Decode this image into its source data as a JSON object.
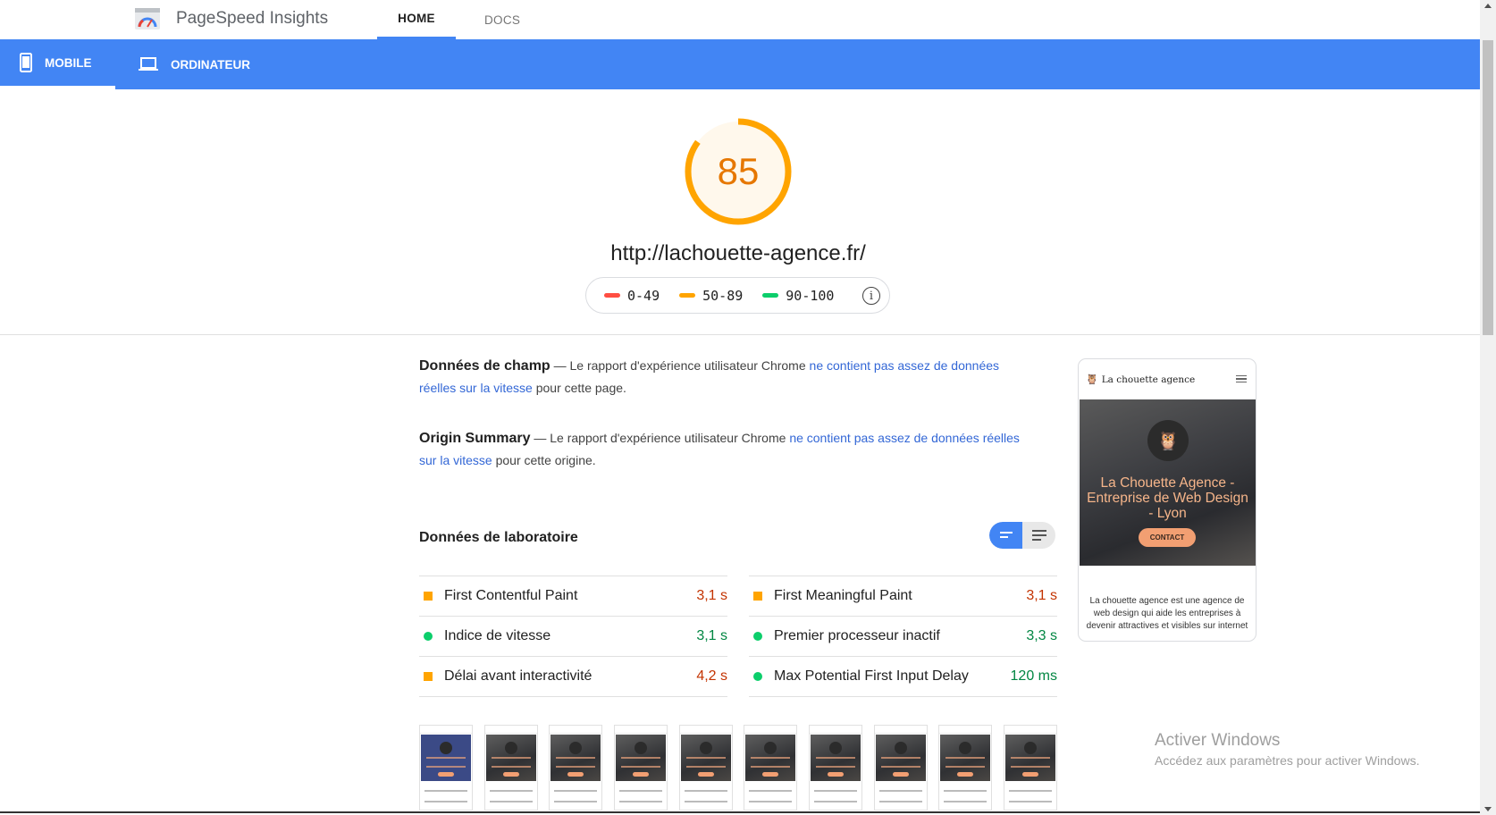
{
  "header": {
    "brand": "PageSpeed Insights",
    "nav": [
      "HOME",
      "DOCS"
    ]
  },
  "device_tabs": {
    "mobile": "MOBILE",
    "desktop": "ORDINATEUR"
  },
  "score": {
    "value": "85",
    "fraction": 0.85,
    "color": "#ffa400"
  },
  "url": "http://lachouette-agence.fr/",
  "legend": {
    "poor": "0-49",
    "average": "50-89",
    "good": "90-100",
    "colors": {
      "poor": "#ff4e42",
      "average": "#ffa400",
      "good": "#0cce6b"
    }
  },
  "field_data": {
    "title": "Données de champ",
    "prefix": " — Le rapport d'expérience utilisateur Chrome ",
    "link": "ne contient pas assez de données réelles sur la vitesse",
    "suffix": " pour cette page."
  },
  "origin_summary": {
    "title": "Origin Summary",
    "prefix": " — Le rapport d'expérience utilisateur Chrome ",
    "link": "ne contient pas assez de données réelles sur la vitesse",
    "suffix": " pour cette origine."
  },
  "lab": {
    "title": "Données de laboratoire",
    "metrics": [
      {
        "label": "First Contentful Paint",
        "value": "3,1 s",
        "status": "average"
      },
      {
        "label": "First Meaningful Paint",
        "value": "3,1 s",
        "status": "average"
      },
      {
        "label": "Indice de vitesse",
        "value": "3,1 s",
        "status": "pass"
      },
      {
        "label": "Premier processeur inactif",
        "value": "3,3 s",
        "status": "pass"
      },
      {
        "label": "Délai avant interactivité",
        "value": "4,2 s",
        "status": "average"
      },
      {
        "label": "Max Potential First Input Delay",
        "value": "120 ms",
        "status": "pass"
      }
    ]
  },
  "preview": {
    "site_name": "La chouette agence",
    "hero_text": "La Chouette Agence - Entreprise de Web Design - Lyon",
    "cta": "CONTACT",
    "body": "La chouette agence est une agence de web design qui aide les entreprises à devenir attractives et visibles sur internet"
  },
  "filmstrip_count": 10,
  "watermark": {
    "title": "Activer Windows",
    "subtitle": "Accédez aux paramètres pour activer Windows."
  }
}
